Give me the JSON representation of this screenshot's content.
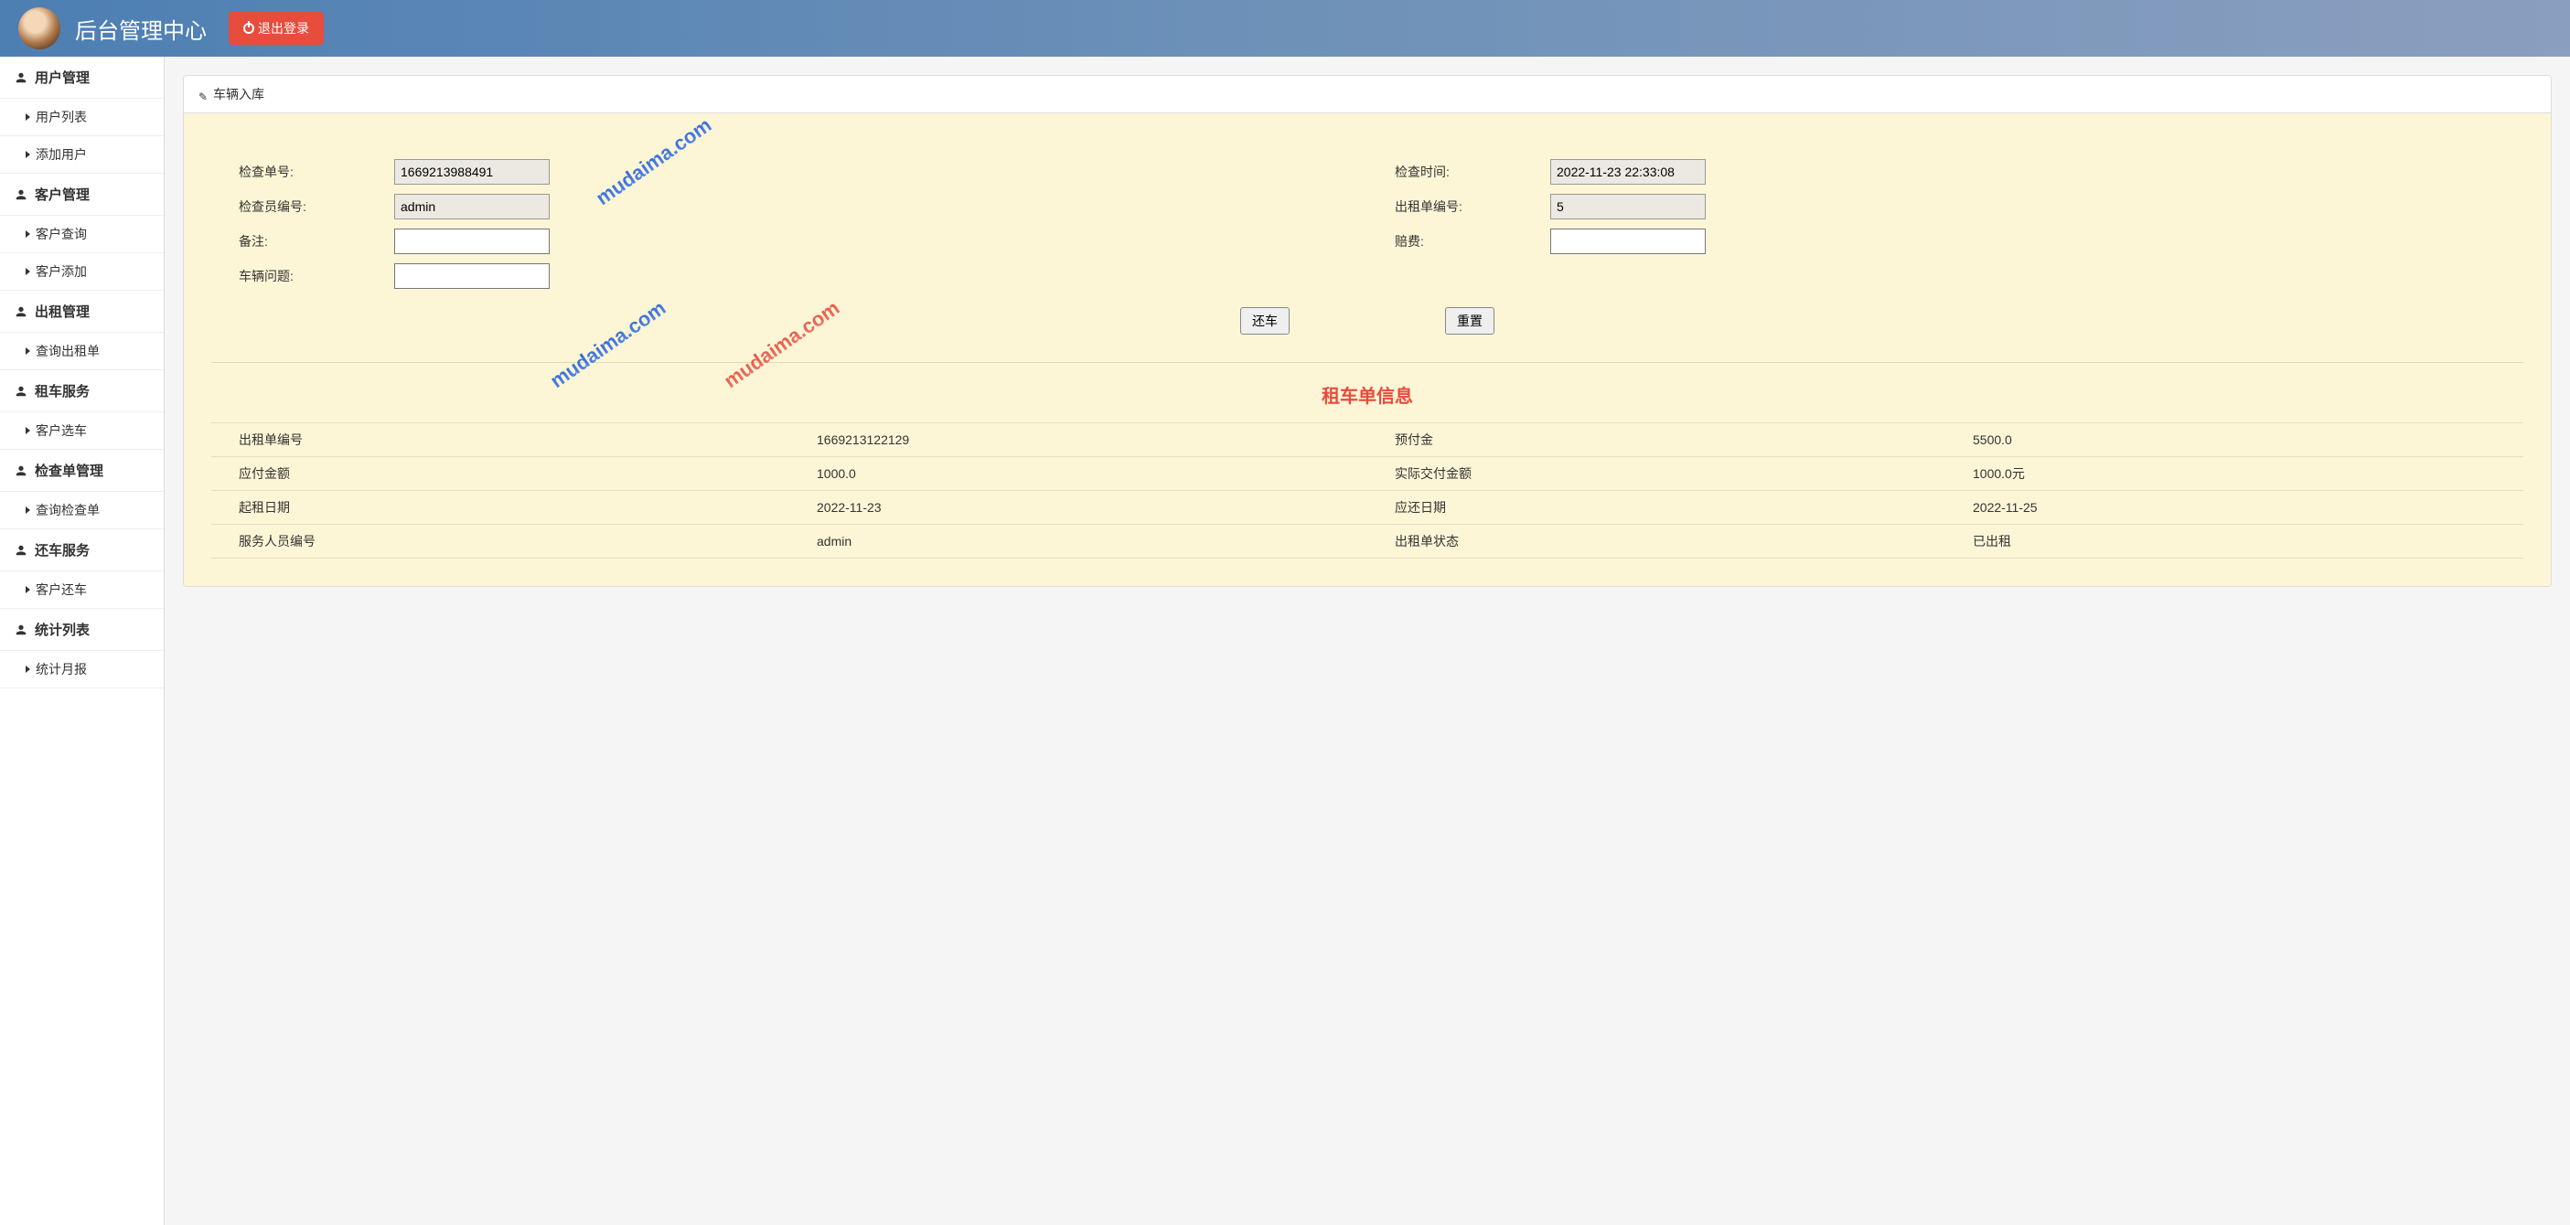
{
  "header": {
    "title": "后台管理中心",
    "logout": "退出登录"
  },
  "sidebar": {
    "groups": [
      {
        "header": "用户管理",
        "items": [
          "用户列表",
          "添加用户"
        ]
      },
      {
        "header": "客户管理",
        "items": [
          "客户查询",
          "客户添加"
        ]
      },
      {
        "header": "出租管理",
        "items": [
          "查询出租单"
        ]
      },
      {
        "header": "租车服务",
        "items": [
          "客户选车"
        ]
      },
      {
        "header": "检查单管理",
        "items": [
          "查询检查单"
        ]
      },
      {
        "header": "还车服务",
        "items": [
          "客户还车"
        ]
      },
      {
        "header": "统计列表",
        "items": [
          "统计月报"
        ]
      }
    ]
  },
  "panel": {
    "title": "车辆入库"
  },
  "form": {
    "check_no_label": "检查单号:",
    "check_no_value": "1669213988491",
    "check_time_label": "检查时间:",
    "check_time_value": "2022-11-23 22:33:08",
    "checker_id_label": "检查员编号:",
    "checker_id_value": "admin",
    "rent_no_label": "出租单编号:",
    "rent_no_value": "5",
    "remark_label": "备注:",
    "remark_value": "",
    "compensation_label": "赔费:",
    "compensation_value": "",
    "car_issue_label": "车辆问题:",
    "car_issue_value": "",
    "submit_btn": "还车",
    "reset_btn": "重置"
  },
  "info": {
    "title": "租车单信息",
    "rows": [
      {
        "k1": "出租单编号",
        "v1": "1669213122129",
        "k2": "预付金",
        "v2": "5500.0"
      },
      {
        "k1": "应付金额",
        "v1": "1000.0",
        "k2": "实际交付金额",
        "v2": "1000.0元"
      },
      {
        "k1": "起租日期",
        "v1": "2022-11-23",
        "k2": "应还日期",
        "v2": "2022-11-25"
      },
      {
        "k1": "服务人员编号",
        "v1": "admin",
        "k2": "出租单状态",
        "v2": "已出租"
      }
    ]
  },
  "watermark": "mudaima.com"
}
